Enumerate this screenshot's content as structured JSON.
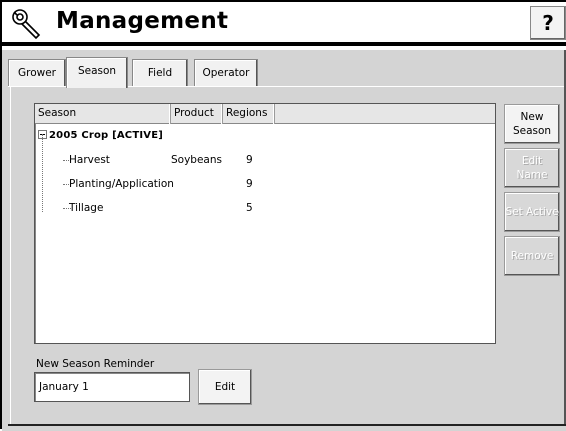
{
  "window": {
    "title": "Management",
    "help_label": "?",
    "title_icon": "wrench-icon"
  },
  "tabs": [
    {
      "label": "Grower",
      "active": false
    },
    {
      "label": "Season",
      "active": true
    },
    {
      "label": "Field",
      "active": false
    },
    {
      "label": "Operator",
      "active": false
    }
  ],
  "table": {
    "columns": [
      "Season",
      "Product",
      "Regions"
    ],
    "group": {
      "label": "2005 Crop  [ACTIVE]",
      "expanded": true
    },
    "rows": [
      {
        "season": "Harvest",
        "product": "Soybeans",
        "regions": "9"
      },
      {
        "season": "Planting/Application",
        "product": "",
        "regions": "9"
      },
      {
        "season": "Tillage",
        "product": "",
        "regions": "5"
      }
    ]
  },
  "side_buttons": {
    "new_season": "New\nSeason",
    "edit_name": "Edit Name",
    "set_active": "Set Active",
    "remove": "Remove"
  },
  "reminder": {
    "label": "New Season Reminder",
    "value": "January 1",
    "edit_label": "Edit"
  }
}
